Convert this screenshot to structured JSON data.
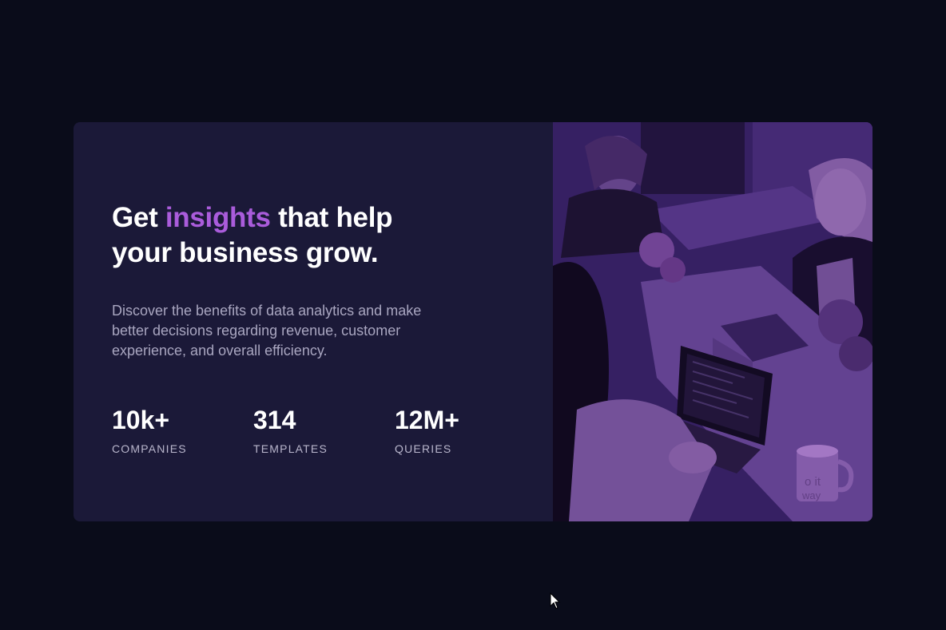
{
  "hero": {
    "title_before": "Get ",
    "title_accent": "insights",
    "title_after": " that help your business grow.",
    "description": "Discover the benefits of data analytics and make better decisions regarding revenue, customer experience, and overall efficiency.",
    "stats": [
      {
        "value": "10k+",
        "label": "COMPANIES"
      },
      {
        "value": "314",
        "label": "TEMPLATES"
      },
      {
        "value": "12M+",
        "label": "QUERIES"
      }
    ]
  },
  "photo": {
    "mug_text_1": "o it",
    "mug_text_2": "way"
  },
  "colors": {
    "page_bg": "#0a0c1a",
    "card_bg": "#1b1938",
    "accent": "#aa5cdb",
    "overlay": "#aa5cdb"
  }
}
